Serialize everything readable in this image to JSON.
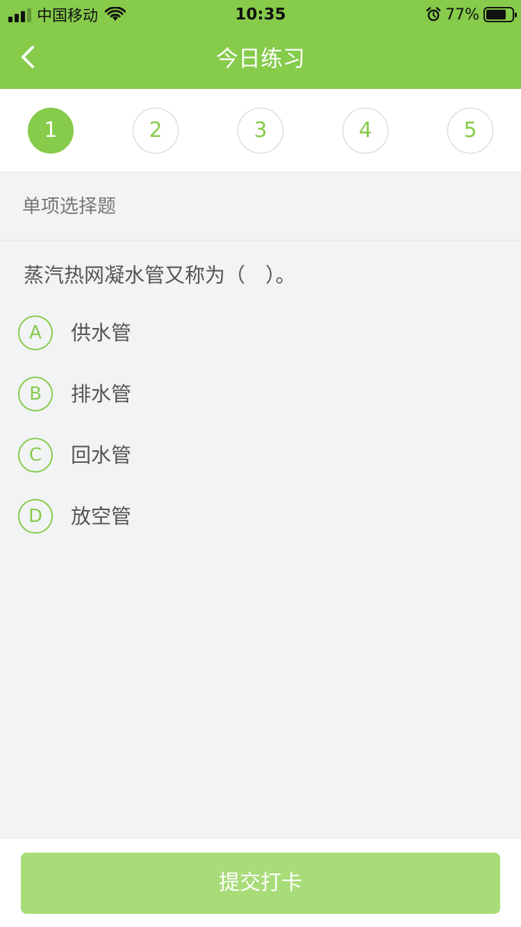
{
  "status_bar": {
    "carrier": "中国移动",
    "time": "10:35",
    "battery_percent": "77%",
    "battery_level": 0.77,
    "icons": [
      "signal-icon",
      "wifi-icon",
      "alarm-icon",
      "battery-icon"
    ]
  },
  "nav": {
    "back_icon": "chevron-left-icon",
    "title": "今日练习"
  },
  "question_numbers": [
    {
      "label": "1",
      "active": true
    },
    {
      "label": "2",
      "active": false
    },
    {
      "label": "3",
      "active": false
    },
    {
      "label": "4",
      "active": false
    },
    {
      "label": "5",
      "active": false
    }
  ],
  "section": {
    "label": "单项选择题"
  },
  "question": {
    "text": "蒸汽热网凝水管又称为（　）。",
    "options": [
      {
        "key": "A",
        "text": "供水管"
      },
      {
        "key": "B",
        "text": "排水管"
      },
      {
        "key": "C",
        "text": "回水管"
      },
      {
        "key": "D",
        "text": "放空管"
      }
    ]
  },
  "footer": {
    "submit_label": "提交打卡"
  },
  "colors": {
    "accent": "#86cb4a",
    "submit_bg": "#a8dc78",
    "page_bg": "#f2f3f5"
  }
}
